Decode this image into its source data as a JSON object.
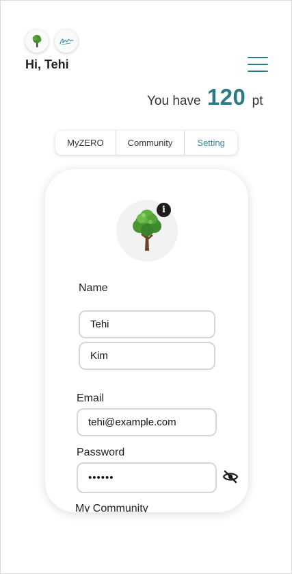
{
  "header": {
    "greeting": "Hi, Tehi",
    "points_prefix": "You have",
    "points_value": "120",
    "points_unit": "pt"
  },
  "tabs": [
    {
      "label": "MyZERO",
      "active": false
    },
    {
      "label": "Community",
      "active": false
    },
    {
      "label": "Setting",
      "active": true
    }
  ],
  "profile": {
    "name_label": "Name",
    "first_name": "Tehi",
    "last_name": "Kim",
    "email_label": "Email",
    "email": "tehi@example.com",
    "password_label": "Password",
    "password_masked": "••••••",
    "community_label": "My Community"
  },
  "colors": {
    "accent": "#2c7a84",
    "active_tab": "#3b8a93"
  },
  "icons": {
    "tree": "tree-icon",
    "signature": "signature-icon",
    "menu": "hamburger-menu-icon",
    "info": "info-icon",
    "password_visibility": "eye-slash-icon"
  }
}
